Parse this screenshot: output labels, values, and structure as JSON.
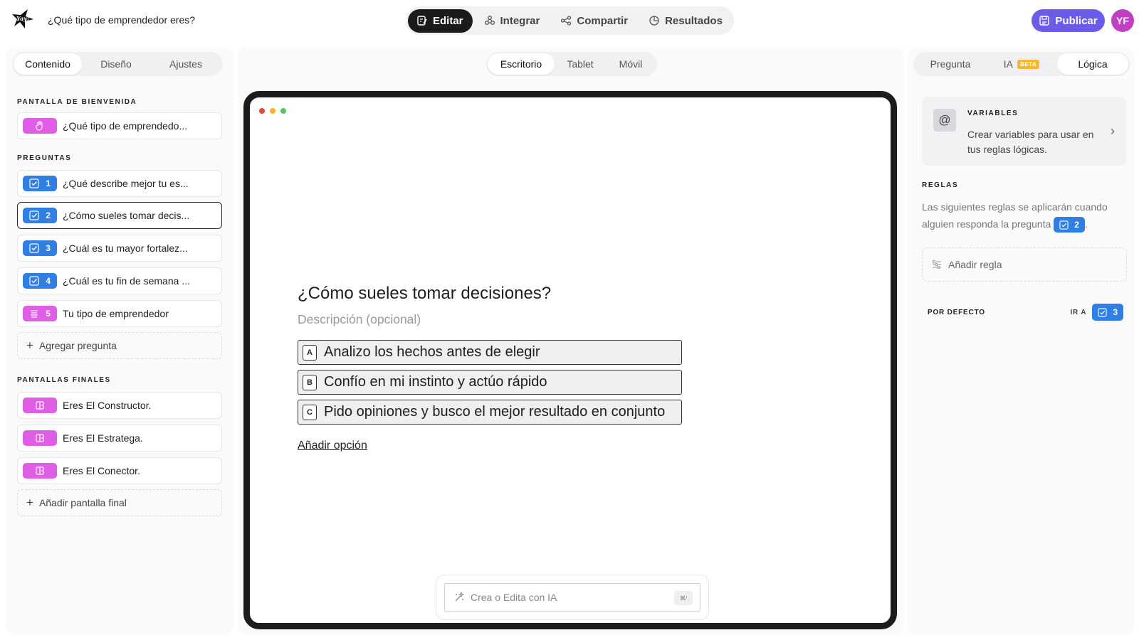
{
  "app": {
    "form_title": "¿Qué tipo de emprendedor eres?",
    "logo_icon": "yay-logo-icon"
  },
  "top_tabs": [
    {
      "label": "Editar",
      "icon": "edit-icon",
      "active": true
    },
    {
      "label": "Integrar",
      "icon": "integrate-icon",
      "active": false
    },
    {
      "label": "Compartir",
      "icon": "share-icon",
      "active": false
    },
    {
      "label": "Resultados",
      "icon": "results-icon",
      "active": false
    }
  ],
  "publish": {
    "label": "Publicar",
    "icon": "publish-icon"
  },
  "user": {
    "initials": "YF",
    "color": "#c13fc3"
  },
  "left_tabs": [
    {
      "label": "Contenido",
      "active": true
    },
    {
      "label": "Diseño",
      "active": false
    },
    {
      "label": "Ajustes",
      "active": false
    }
  ],
  "welcome": {
    "section_label": "PANTALLA DE BIENVENIDA",
    "item": {
      "text": "¿Qué tipo de emprendedo...",
      "icon": "hand-icon"
    }
  },
  "questions": {
    "section_label": "PREGUNTAS",
    "items": [
      {
        "num": "1",
        "text": "¿Qué describe mejor tu es...",
        "icon": "checkbox-icon",
        "selected": false
      },
      {
        "num": "2",
        "text": "¿Cómo sueles tomar decis...",
        "icon": "checkbox-icon",
        "selected": true
      },
      {
        "num": "3",
        "text": "¿Cuál es tu mayor fortalez...",
        "icon": "checkbox-icon",
        "selected": false
      },
      {
        "num": "4",
        "text": "¿Cuál es tu fin de semana ...",
        "icon": "checkbox-icon",
        "selected": false
      },
      {
        "num": "5",
        "text": "Tu tipo de emprendedor",
        "icon": "text-lines-icon",
        "selected": false
      }
    ],
    "add_label": "Agregar pregunta"
  },
  "endings": {
    "section_label": "PANTALLAS FINALES",
    "items": [
      {
        "text": "Eres El Constructor.",
        "icon": "exit-icon"
      },
      {
        "text": "Eres El Estratega.",
        "icon": "exit-icon"
      },
      {
        "text": "Eres El Conector.",
        "icon": "exit-icon"
      }
    ],
    "add_label": "Añadir pantalla final"
  },
  "device_tabs": [
    {
      "label": "Escritorio",
      "active": true
    },
    {
      "label": "Tablet",
      "active": false
    },
    {
      "label": "Móvil",
      "active": false
    }
  ],
  "preview": {
    "window_dot_colors": [
      "#e5483f",
      "#f1b62c",
      "#56c46c"
    ],
    "question_title": "¿Cómo sueles tomar decisiones?",
    "description_placeholder": "Descripción (opcional)",
    "options": [
      {
        "key": "A",
        "text": "Analizo los hechos antes de elegir"
      },
      {
        "key": "B",
        "text": "Confío en mi instinto y actúo rápido"
      },
      {
        "key": "C",
        "text": "Pido opiniones y busco el mejor resultado en conjunto"
      }
    ],
    "add_option": "Añadir opción"
  },
  "ai": {
    "placeholder": "Crea o Edita con IA",
    "shortcut": "⌘/",
    "icon": "sparkle-icon"
  },
  "right_tabs": [
    {
      "label": "Pregunta",
      "active": false
    },
    {
      "label": "IA",
      "badge": "BETA",
      "active": false
    },
    {
      "label": "Lógica",
      "active": true
    }
  ],
  "variables": {
    "title": "VARIABLES",
    "description": "Crear variables para usar en tus reglas lógicas.",
    "icon": "at-icon"
  },
  "rules": {
    "title": "REGLAS",
    "description": "Las siguientes reglas se aplicarán cuando alguien responda la pregunta",
    "question_ref": "2",
    "suffix": ".",
    "add_label": "Añadir regla",
    "add_icon": "rule-icon"
  },
  "default_rule": {
    "label": "POR DEFECTO",
    "goto_label": "IR A",
    "target": "3"
  },
  "colors": {
    "accent": "#6b5ce7",
    "question_badge": "#2f7fe5",
    "screen_badge": "#e05de6"
  }
}
